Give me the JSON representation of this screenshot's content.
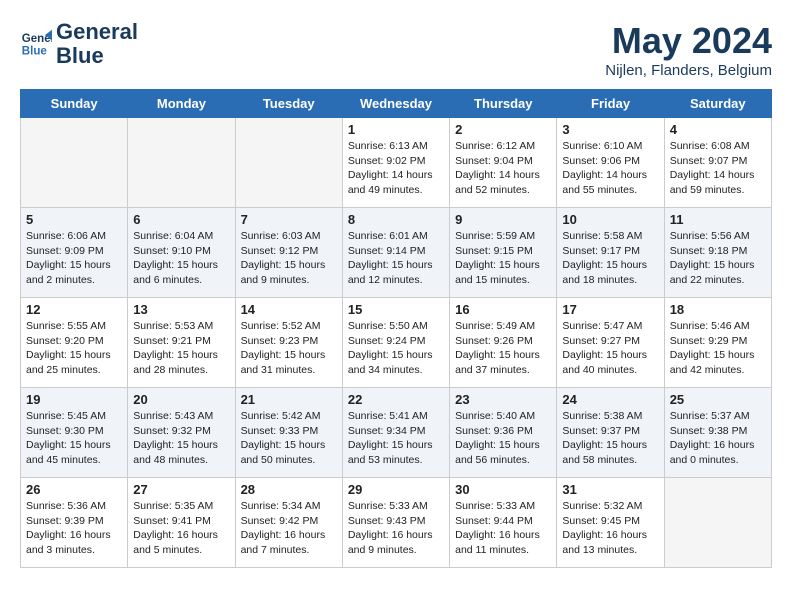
{
  "logo": {
    "line1": "General",
    "line2": "Blue"
  },
  "title": "May 2024",
  "location": "Nijlen, Flanders, Belgium",
  "weekdays": [
    "Sunday",
    "Monday",
    "Tuesday",
    "Wednesday",
    "Thursday",
    "Friday",
    "Saturday"
  ],
  "weeks": [
    [
      {
        "num": "",
        "info": ""
      },
      {
        "num": "",
        "info": ""
      },
      {
        "num": "",
        "info": ""
      },
      {
        "num": "1",
        "info": "Sunrise: 6:13 AM\nSunset: 9:02 PM\nDaylight: 14 hours\nand 49 minutes."
      },
      {
        "num": "2",
        "info": "Sunrise: 6:12 AM\nSunset: 9:04 PM\nDaylight: 14 hours\nand 52 minutes."
      },
      {
        "num": "3",
        "info": "Sunrise: 6:10 AM\nSunset: 9:06 PM\nDaylight: 14 hours\nand 55 minutes."
      },
      {
        "num": "4",
        "info": "Sunrise: 6:08 AM\nSunset: 9:07 PM\nDaylight: 14 hours\nand 59 minutes."
      }
    ],
    [
      {
        "num": "5",
        "info": "Sunrise: 6:06 AM\nSunset: 9:09 PM\nDaylight: 15 hours\nand 2 minutes."
      },
      {
        "num": "6",
        "info": "Sunrise: 6:04 AM\nSunset: 9:10 PM\nDaylight: 15 hours\nand 6 minutes."
      },
      {
        "num": "7",
        "info": "Sunrise: 6:03 AM\nSunset: 9:12 PM\nDaylight: 15 hours\nand 9 minutes."
      },
      {
        "num": "8",
        "info": "Sunrise: 6:01 AM\nSunset: 9:14 PM\nDaylight: 15 hours\nand 12 minutes."
      },
      {
        "num": "9",
        "info": "Sunrise: 5:59 AM\nSunset: 9:15 PM\nDaylight: 15 hours\nand 15 minutes."
      },
      {
        "num": "10",
        "info": "Sunrise: 5:58 AM\nSunset: 9:17 PM\nDaylight: 15 hours\nand 18 minutes."
      },
      {
        "num": "11",
        "info": "Sunrise: 5:56 AM\nSunset: 9:18 PM\nDaylight: 15 hours\nand 22 minutes."
      }
    ],
    [
      {
        "num": "12",
        "info": "Sunrise: 5:55 AM\nSunset: 9:20 PM\nDaylight: 15 hours\nand 25 minutes."
      },
      {
        "num": "13",
        "info": "Sunrise: 5:53 AM\nSunset: 9:21 PM\nDaylight: 15 hours\nand 28 minutes."
      },
      {
        "num": "14",
        "info": "Sunrise: 5:52 AM\nSunset: 9:23 PM\nDaylight: 15 hours\nand 31 minutes."
      },
      {
        "num": "15",
        "info": "Sunrise: 5:50 AM\nSunset: 9:24 PM\nDaylight: 15 hours\nand 34 minutes."
      },
      {
        "num": "16",
        "info": "Sunrise: 5:49 AM\nSunset: 9:26 PM\nDaylight: 15 hours\nand 37 minutes."
      },
      {
        "num": "17",
        "info": "Sunrise: 5:47 AM\nSunset: 9:27 PM\nDaylight: 15 hours\nand 40 minutes."
      },
      {
        "num": "18",
        "info": "Sunrise: 5:46 AM\nSunset: 9:29 PM\nDaylight: 15 hours\nand 42 minutes."
      }
    ],
    [
      {
        "num": "19",
        "info": "Sunrise: 5:45 AM\nSunset: 9:30 PM\nDaylight: 15 hours\nand 45 minutes."
      },
      {
        "num": "20",
        "info": "Sunrise: 5:43 AM\nSunset: 9:32 PM\nDaylight: 15 hours\nand 48 minutes."
      },
      {
        "num": "21",
        "info": "Sunrise: 5:42 AM\nSunset: 9:33 PM\nDaylight: 15 hours\nand 50 minutes."
      },
      {
        "num": "22",
        "info": "Sunrise: 5:41 AM\nSunset: 9:34 PM\nDaylight: 15 hours\nand 53 minutes."
      },
      {
        "num": "23",
        "info": "Sunrise: 5:40 AM\nSunset: 9:36 PM\nDaylight: 15 hours\nand 56 minutes."
      },
      {
        "num": "24",
        "info": "Sunrise: 5:38 AM\nSunset: 9:37 PM\nDaylight: 15 hours\nand 58 minutes."
      },
      {
        "num": "25",
        "info": "Sunrise: 5:37 AM\nSunset: 9:38 PM\nDaylight: 16 hours\nand 0 minutes."
      }
    ],
    [
      {
        "num": "26",
        "info": "Sunrise: 5:36 AM\nSunset: 9:39 PM\nDaylight: 16 hours\nand 3 minutes."
      },
      {
        "num": "27",
        "info": "Sunrise: 5:35 AM\nSunset: 9:41 PM\nDaylight: 16 hours\nand 5 minutes."
      },
      {
        "num": "28",
        "info": "Sunrise: 5:34 AM\nSunset: 9:42 PM\nDaylight: 16 hours\nand 7 minutes."
      },
      {
        "num": "29",
        "info": "Sunrise: 5:33 AM\nSunset: 9:43 PM\nDaylight: 16 hours\nand 9 minutes."
      },
      {
        "num": "30",
        "info": "Sunrise: 5:33 AM\nSunset: 9:44 PM\nDaylight: 16 hours\nand 11 minutes."
      },
      {
        "num": "31",
        "info": "Sunrise: 5:32 AM\nSunset: 9:45 PM\nDaylight: 16 hours\nand 13 minutes."
      },
      {
        "num": "",
        "info": ""
      }
    ]
  ]
}
